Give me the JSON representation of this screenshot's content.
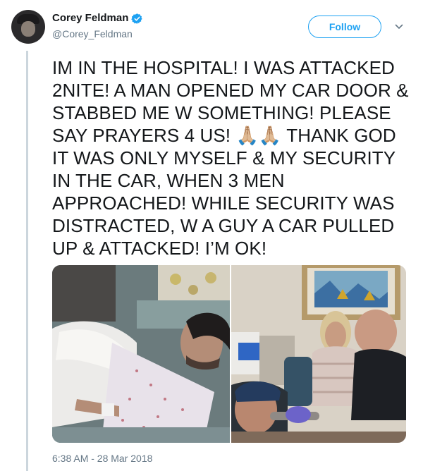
{
  "author": {
    "name": "Corey Feldman",
    "handle": "@Corey_Feldman",
    "verified": true
  },
  "actions": {
    "follow_label": "Follow",
    "more_icon": "chevron-down-icon"
  },
  "tweet": {
    "text": "IM IN THE HOSPITAL! I WAS ATTACKED 2NITE! A MAN OPENED MY CAR DOOR & STABBED ME W SOMETHING! PLEASE SAY PRAYERS 4 US! 🙏🏼🙏🏼 THANK GOD IT WAS ONLY MYSELF & MY SECURITY IN THE CAR, WHEN 3 MEN APPROACHED! WHILE SECURITY WAS DISTRACTED, W A GUY A CAR PULLED UP & ATTACKED! I’M OK!",
    "timestamp": "6:38 AM - 28 Mar 2018"
  },
  "colors": {
    "accent": "#1da1f2",
    "secondary_text": "#657786",
    "thread_line": "#ccd6dd"
  }
}
